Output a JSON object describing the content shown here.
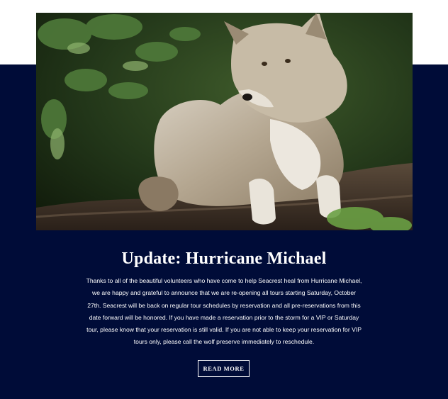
{
  "post": {
    "image_alt": "Gray wolf resting on a log",
    "title": "Update: Hurricane Michael",
    "body": "Thanks to all of the beautiful volunteers who have come to help Seacrest heal from Hurricane Michael, we are happy and grateful to announce that we are re-opening all tours starting Saturday, October 27th. Seacrest will be back on regular tour schedules by reservation and all pre-reservations from this date forward will be honored. If you have made a reservation prior to the storm for a VIP or Saturday tour, please know that your reservation is still valid. If you are not able to keep your reservation for VIP tours only, please call the wolf preserve immediately to reschedule.",
    "read_more_label": "READ MORE"
  },
  "colors": {
    "band": "#000c38",
    "text": "#ffffff",
    "page": "#ffffff"
  }
}
